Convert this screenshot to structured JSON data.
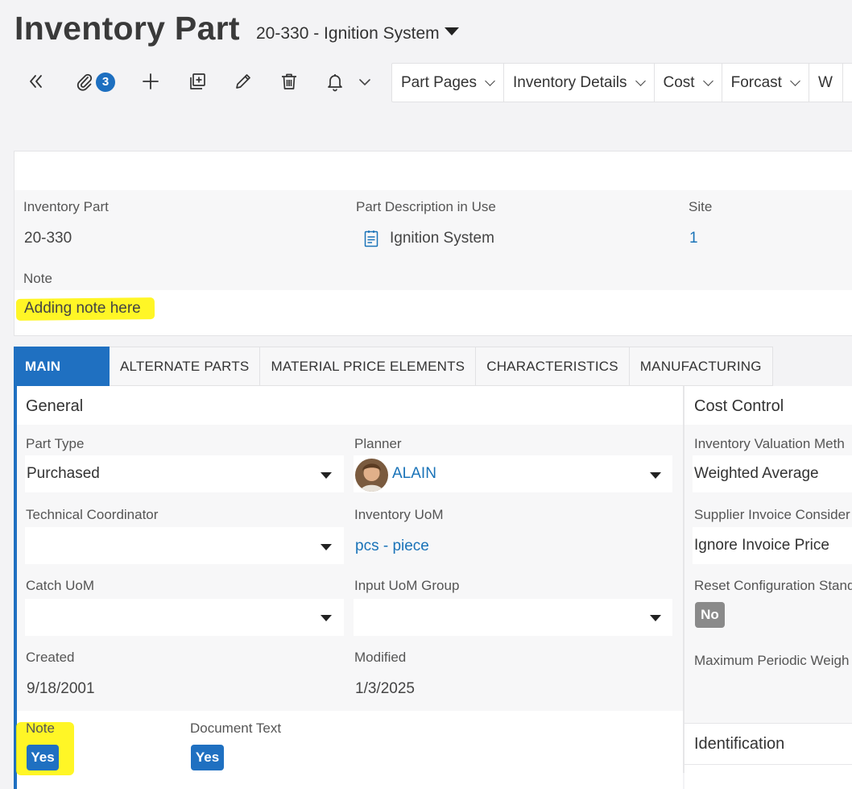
{
  "header": {
    "page_title": "Inventory Part",
    "record_title": "20-330 - Ignition System"
  },
  "toolbar": {
    "attachments_count": "3",
    "nav_buttons": [
      "Part Pages",
      "Inventory Details",
      "Cost",
      "Forcast",
      "W"
    ]
  },
  "header_card": {
    "inventory_part_label": "Inventory Part",
    "inventory_part_value": "20-330",
    "part_desc_label": "Part Description in Use",
    "part_desc_value": "Ignition System",
    "site_label": "Site",
    "site_value": "1",
    "note_label": "Note",
    "note_value": "Adding note here"
  },
  "tabs": [
    "MAIN",
    "ALTERNATE PARTS",
    "MATERIAL PRICE ELEMENTS",
    "CHARACTERISTICS",
    "MANUFACTURING"
  ],
  "general": {
    "title": "General",
    "part_type_label": "Part Type",
    "part_type_value": "Purchased",
    "planner_label": "Planner",
    "planner_value": "ALAIN",
    "tech_coord_label": "Technical Coordinator",
    "tech_coord_value": "",
    "inv_uom_label": "Inventory UoM",
    "inv_uom_value": "pcs - piece",
    "catch_uom_label": "Catch UoM",
    "catch_uom_value": "",
    "input_uom_label": "Input UoM Group",
    "input_uom_value": "",
    "created_label": "Created",
    "created_value": "9/18/2001",
    "modified_label": "Modified",
    "modified_value": "1/3/2025",
    "note_label": "Note",
    "note_toggle": "Yes",
    "doc_text_label": "Document Text",
    "doc_text_toggle": "Yes"
  },
  "cost_control": {
    "title": "Cost Control",
    "valuation_label": "Inventory Valuation Meth",
    "valuation_value": "Weighted Average",
    "supplier_label": "Supplier Invoice Consider",
    "supplier_value": "Ignore Invoice Price",
    "reset_label": "Reset Configuration Stand",
    "reset_toggle": "No",
    "max_label": "Maximum Periodic Weigh"
  },
  "identification": {
    "title": "Identification"
  },
  "colors": {
    "accent": "#1f70c1",
    "link": "#1a73b8",
    "highlight": "#fff500",
    "toggle_no": "#8a8a8a"
  },
  "icons": [
    "collapse-icon",
    "paperclip-icon",
    "plus-icon",
    "duplicate-icon",
    "pencil-icon",
    "trash-icon",
    "bell-icon",
    "chevron-down-icon",
    "document-icon",
    "avatar"
  ]
}
